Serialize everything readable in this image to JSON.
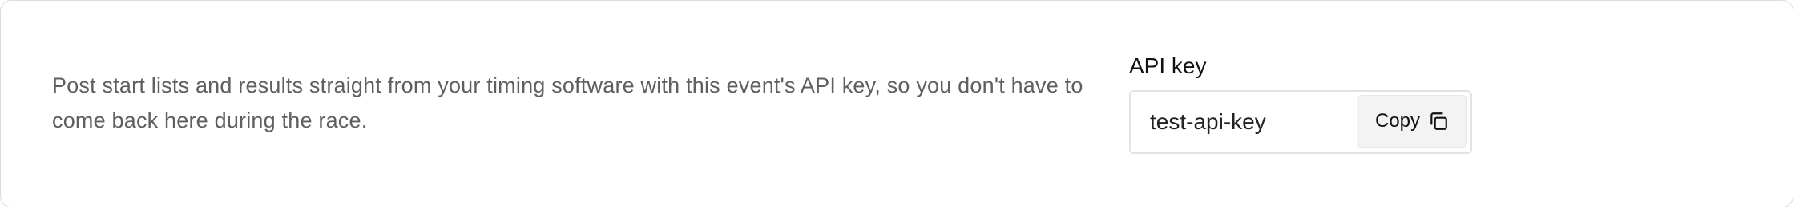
{
  "card": {
    "description": "Post start lists and results straight from your timing software with this event's API key, so you don't have to come back here during the race."
  },
  "api_key": {
    "label": "API key",
    "value": "test-api-key",
    "copy_label": "Copy",
    "copy_icon": "copy-icon"
  }
}
